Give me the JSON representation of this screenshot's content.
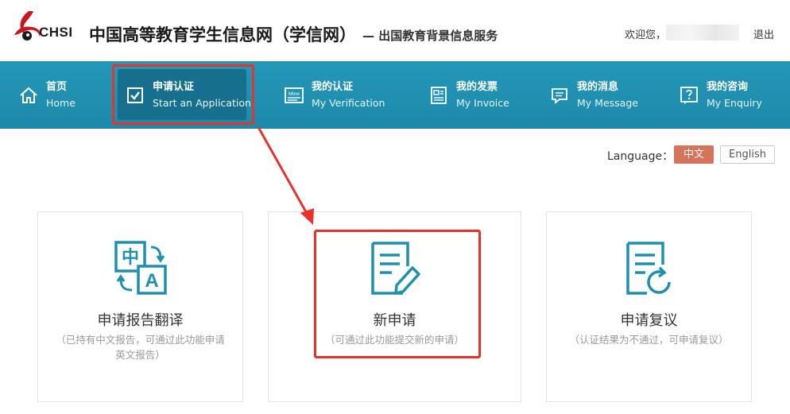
{
  "header": {
    "logo_text": "CHSI",
    "site_title": "中国高等教育学生信息网（学信网）",
    "site_subtitle": "— 出国教育背景信息服务",
    "welcome": "欢迎您，",
    "logout": "退出"
  },
  "nav": {
    "items": [
      {
        "cn": "首页",
        "en": "Home",
        "icon": "home-icon"
      },
      {
        "cn": "申请认证",
        "en": "Start an Application",
        "icon": "checkbox-icon",
        "active": true
      },
      {
        "cn": "我的认证",
        "en": "My Verification",
        "icon": "mine-icon"
      },
      {
        "cn": "我的发票",
        "en": "My Invoice",
        "icon": "invoice-icon"
      },
      {
        "cn": "我的消息",
        "en": "My Message",
        "icon": "message-icon"
      },
      {
        "cn": "我的咨询",
        "en": "My Enquiry",
        "icon": "enquiry-icon"
      }
    ],
    "mine_icon_label": "Mine"
  },
  "language": {
    "label": "Language：",
    "zh": "中文",
    "en": "English",
    "active": "zh"
  },
  "cards": [
    {
      "title": "申请报告翻译",
      "desc_line1": "（已持有中文报告，可通过此功能申请",
      "desc_line2": "英文报告）",
      "icon": "translate-icon",
      "icon_text_zh": "中",
      "icon_text_en": "A"
    },
    {
      "title": "新申请",
      "desc_line1": "（可通过此功能提交新的申请）",
      "icon": "document-edit-icon"
    },
    {
      "title": "申请复议",
      "desc_line1": "（认证结果为不通过，可申请复议）",
      "icon": "document-refresh-icon"
    }
  ],
  "colors": {
    "nav_bg": "#2497b8",
    "nav_active": "#166f8d",
    "icon_teal": "#1f8fb0",
    "lang_active": "#d5735b",
    "highlight_red": "#e8322c"
  }
}
